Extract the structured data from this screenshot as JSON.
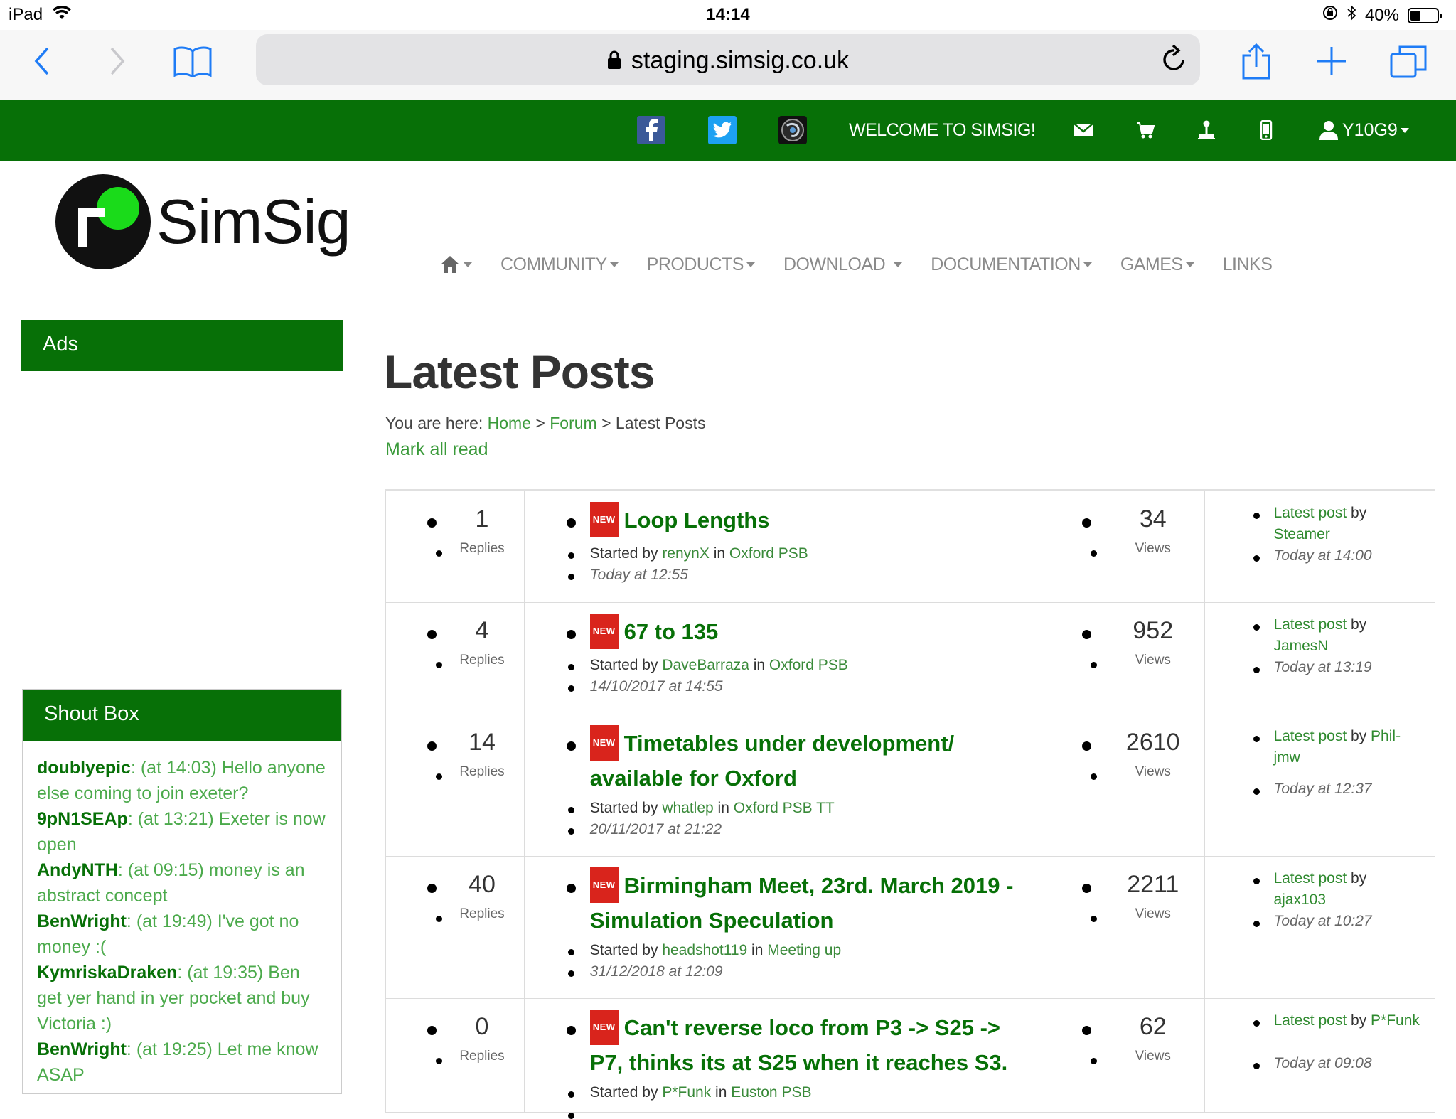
{
  "status_bar": {
    "device": "iPad",
    "time": "14:14",
    "battery": "40%",
    "battery_level": 0.4
  },
  "browser": {
    "url": "staging.simsig.co.uk"
  },
  "topnav": {
    "welcome": "WELCOME TO SIMSIG!",
    "user": "Y10G9"
  },
  "logo": {
    "brand": "SimSig"
  },
  "mainnav": {
    "items": [
      "COMMUNITY",
      "PRODUCTS",
      "DOWNLOAD",
      "DOCUMENTATION",
      "GAMES",
      "LINKS"
    ]
  },
  "sidebar": {
    "ads_title": "Ads",
    "shout_title": "Shout Box",
    "shouts": [
      {
        "user": "doublyepic",
        "text": ": (at 14:03) Hello anyone else coming to join exeter?"
      },
      {
        "user": "9pN1SEAp",
        "text": ": (at 13:21) Exeter is now open"
      },
      {
        "user": "AndyNTH",
        "text": ": (at 09:15) money is an abstract concept"
      },
      {
        "user": "BenWright",
        "text": ": (at 19:49) I've got no money :("
      },
      {
        "user": "KymriskaDraken",
        "text": ": (at 19:35) Ben get yer hand in yer pocket and buy Victoria :)"
      },
      {
        "user": "BenWright",
        "text": ": (at 19:25) Let me know ASAP"
      }
    ]
  },
  "main": {
    "title": "Latest Posts",
    "crumb_prefix": "You are here:",
    "crumb_home": "Home",
    "crumb_forum": "Forum",
    "crumb_current": "Latest Posts",
    "mark_all_read": "Mark all read",
    "replies_label": "Replies",
    "views_label": "Views",
    "new_badge": "NEW",
    "started_by": "Started by",
    "in_word": "in",
    "latest_post": "Latest post",
    "by_word": "by",
    "posts": [
      {
        "replies": "1",
        "title": "Loop Lengths",
        "author": "renynX",
        "forum": "Oxford PSB",
        "date": "Today at 12:55",
        "views": "34",
        "latest_by": "Steamer",
        "latest_date": "Today at 14:00"
      },
      {
        "replies": "4",
        "title": "67 to 135",
        "author": "DaveBarraza",
        "forum": "Oxford PSB",
        "date": "14/10/2017 at 14:55",
        "views": "952",
        "latest_by": "JamesN",
        "latest_date": "Today at 13:19"
      },
      {
        "replies": "14",
        "title": "Timetables under development/ available for Oxford",
        "author": "whatlep",
        "forum": "Oxford PSB TT",
        "date": "20/11/2017 at 21:22",
        "views": "2610",
        "latest_by": "Phil-jmw",
        "latest_date": "Today at 12:37"
      },
      {
        "replies": "40",
        "title": "Birmingham Meet, 23rd. March 2019 - Simulation Speculation",
        "author": "headshot119",
        "forum": "Meeting up",
        "date": "31/12/2018 at 12:09",
        "views": "2211",
        "latest_by": "ajax103",
        "latest_date": "Today at 10:27"
      },
      {
        "replies": "0",
        "title": "Can't reverse loco from P3 -> S25 -> P7, thinks its at S25 when it reaches S3.",
        "author": "P*Funk",
        "forum": "Euston PSB",
        "date": "",
        "views": "62",
        "latest_by": "P*Funk",
        "latest_date": "Today at 09:08"
      }
    ]
  }
}
